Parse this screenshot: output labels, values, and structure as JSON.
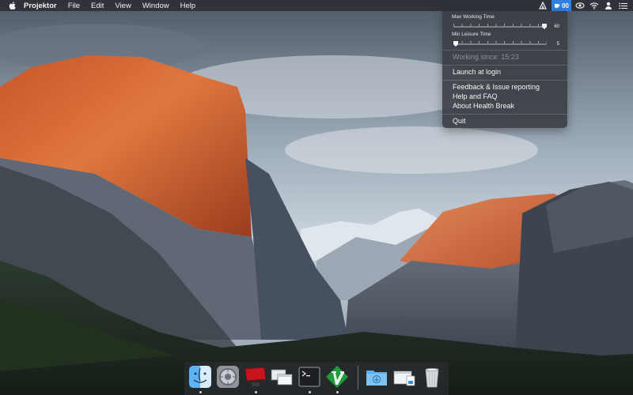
{
  "menubar": {
    "app_name": "Projektor",
    "items": [
      "File",
      "Edit",
      "View",
      "Window",
      "Help"
    ],
    "health_break_label": "00"
  },
  "dropdown": {
    "max_working_label": "Max Working Time",
    "max_working_value": "60",
    "max_working_level": 1.0,
    "min_leisure_label": "Min Leisure Time",
    "min_leisure_value": "5",
    "min_leisure_level": 0.0,
    "working_since": "Working since: 15:23",
    "launch_at_login": "Launch at login",
    "feedback": "Feedback & Issue reporting",
    "help_faq": "Help and FAQ",
    "about": "About Health Break",
    "quit": "Quit"
  },
  "dock": {
    "apps": [
      "finder-icon",
      "system-preferences-icon",
      "projektor-icon",
      "mission-control-icon",
      "terminal-icon",
      "vim-icon"
    ],
    "right_items": [
      "downloads-folder-icon",
      "document-stack-icon",
      "trash-icon"
    ]
  },
  "colors": {
    "menubar_bg": "#2a2c30",
    "accent": "#2f80e0",
    "dropdown_bg": "#3a3e44"
  }
}
